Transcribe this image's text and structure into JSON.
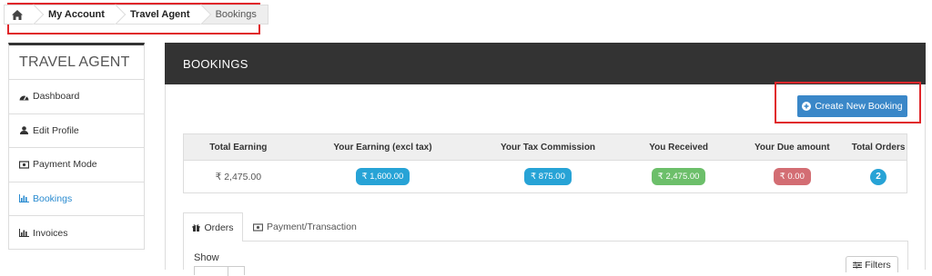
{
  "breadcrumb": {
    "home_icon": "home-icon",
    "items": [
      "My Account",
      "Travel Agent",
      "Bookings"
    ]
  },
  "sidebar": {
    "title": "TRAVEL AGENT",
    "items": [
      {
        "label": "Dashboard",
        "icon": "dashboard-icon"
      },
      {
        "label": "Edit Profile",
        "icon": "user-icon"
      },
      {
        "label": "Payment Mode",
        "icon": "money-icon"
      },
      {
        "label": "Bookings",
        "icon": "bar-chart-icon",
        "active": true
      },
      {
        "label": "Invoices",
        "icon": "bar-chart-icon"
      }
    ]
  },
  "panel": {
    "title": "BOOKINGS",
    "create_button": "Create New Booking"
  },
  "stats": {
    "headers": [
      "Total Earning",
      "Your Earning (excl tax)",
      "Your Tax Commission",
      "You Received",
      "Your Due amount",
      "Total Orders"
    ],
    "values": [
      "₹ 2,475.00",
      "₹ 1,600.00",
      "₹ 875.00",
      "₹ 2,475.00",
      "₹ 0.00",
      "2"
    ]
  },
  "tabs": {
    "orders": "Orders",
    "payment": "Payment/Transaction"
  },
  "table_controls": {
    "show_label": "Show",
    "filters_button": "Filters"
  },
  "colors": {
    "accent": "#3a87c8",
    "header_dark": "#333333",
    "badge_blue": "#27a3d6",
    "badge_green": "#6cbf6a",
    "badge_red": "#d36d73",
    "highlight_box": "#e0262a"
  }
}
